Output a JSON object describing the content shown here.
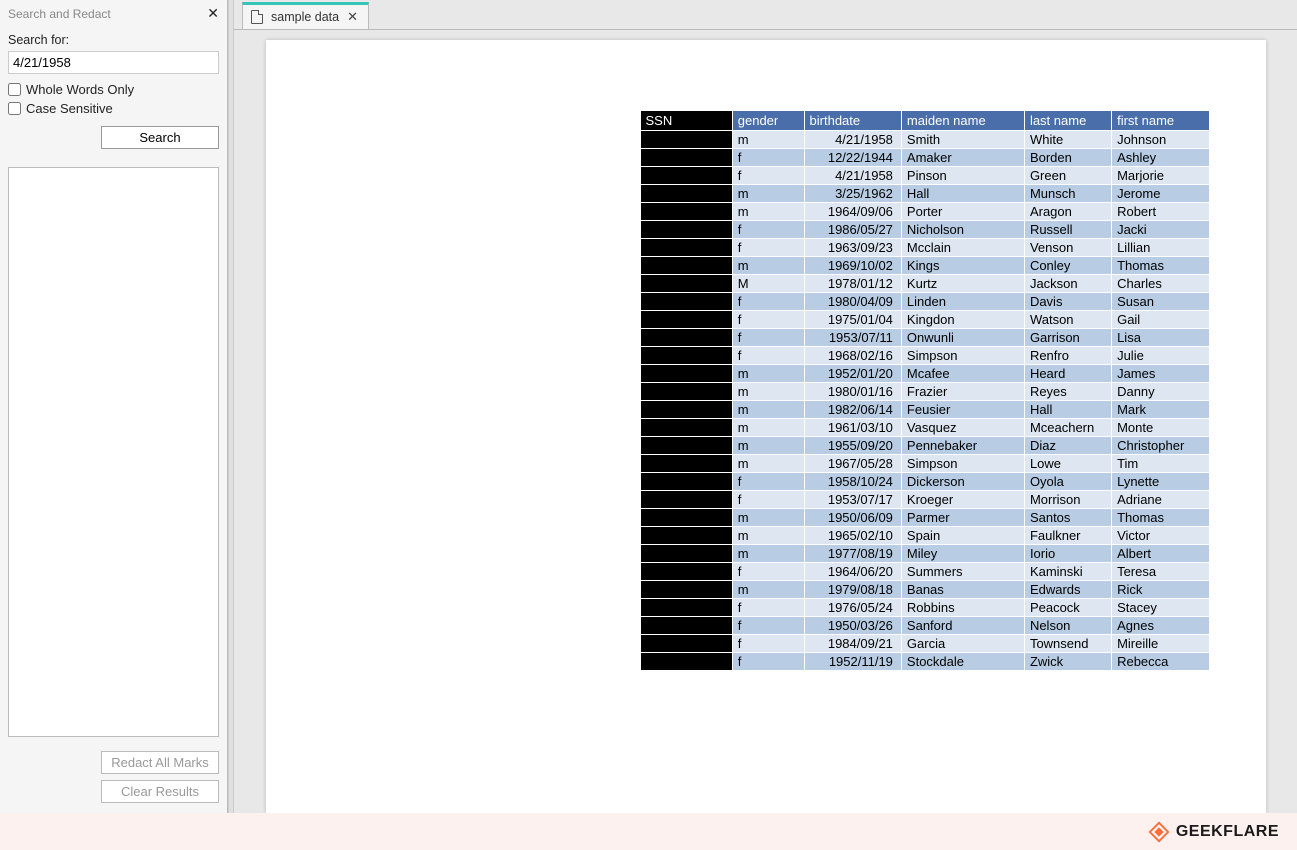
{
  "panel": {
    "title": "Search and Redact",
    "close": "✕",
    "search_label": "Search for:",
    "search_value": "4/21/1958",
    "whole_words": "Whole Words Only",
    "case_sensitive": "Case Sensitive",
    "search_btn": "Search",
    "redact_btn": "Redact All Marks",
    "clear_btn": "Clear Results"
  },
  "tab": {
    "label": "sample data",
    "close": "✕"
  },
  "table": {
    "headers": [
      "SSN",
      "gender",
      "birthdate",
      "maiden name",
      "last name",
      "first name"
    ],
    "rows": [
      {
        "g": "m",
        "bd": "4/21/1958",
        "mn": "Smith",
        "ln": "White",
        "fn": "Johnson"
      },
      {
        "g": "f",
        "bd": "12/22/1944",
        "mn": "Amaker",
        "ln": "Borden",
        "fn": "Ashley"
      },
      {
        "g": "f",
        "bd": "4/21/1958",
        "mn": "Pinson",
        "ln": "Green",
        "fn": "Marjorie"
      },
      {
        "g": "m",
        "bd": "3/25/1962",
        "mn": "Hall",
        "ln": "Munsch",
        "fn": "Jerome"
      },
      {
        "g": "m",
        "bd": "1964/09/06",
        "mn": "Porter",
        "ln": "Aragon",
        "fn": "Robert"
      },
      {
        "g": "f",
        "bd": "1986/05/27",
        "mn": "Nicholson",
        "ln": "Russell",
        "fn": "Jacki"
      },
      {
        "g": "f",
        "bd": "1963/09/23",
        "mn": "Mcclain",
        "ln": "Venson",
        "fn": "Lillian"
      },
      {
        "g": "m",
        "bd": "1969/10/02",
        "mn": "Kings",
        "ln": "Conley",
        "fn": "Thomas"
      },
      {
        "g": "M",
        "bd": "1978/01/12",
        "mn": "Kurtz",
        "ln": "Jackson",
        "fn": "Charles"
      },
      {
        "g": "f",
        "bd": "1980/04/09",
        "mn": "Linden",
        "ln": "Davis",
        "fn": "Susan"
      },
      {
        "g": "f",
        "bd": "1975/01/04",
        "mn": "Kingdon",
        "ln": "Watson",
        "fn": "Gail"
      },
      {
        "g": "f",
        "bd": "1953/07/11",
        "mn": "Onwunli",
        "ln": "Garrison",
        "fn": "Lisa"
      },
      {
        "g": "f",
        "bd": "1968/02/16",
        "mn": "Simpson",
        "ln": "Renfro",
        "fn": "Julie"
      },
      {
        "g": "m",
        "bd": "1952/01/20",
        "mn": "Mcafee",
        "ln": "Heard",
        "fn": "James"
      },
      {
        "g": "m",
        "bd": "1980/01/16",
        "mn": "Frazier",
        "ln": "Reyes",
        "fn": "Danny"
      },
      {
        "g": "m",
        "bd": "1982/06/14",
        "mn": "Feusier",
        "ln": "Hall",
        "fn": "Mark"
      },
      {
        "g": "m",
        "bd": "1961/03/10",
        "mn": "Vasquez",
        "ln": "Mceachern",
        "fn": "Monte"
      },
      {
        "g": "m",
        "bd": "1955/09/20",
        "mn": "Pennebaker",
        "ln": "Diaz",
        "fn": "Christopher"
      },
      {
        "g": "m",
        "bd": "1967/05/28",
        "mn": "Simpson",
        "ln": "Lowe",
        "fn": "Tim"
      },
      {
        "g": "f",
        "bd": "1958/10/24",
        "mn": "Dickerson",
        "ln": "Oyola",
        "fn": "Lynette"
      },
      {
        "g": "f",
        "bd": "1953/07/17",
        "mn": "Kroeger",
        "ln": "Morrison",
        "fn": "Adriane"
      },
      {
        "g": "m",
        "bd": "1950/06/09",
        "mn": "Parmer",
        "ln": "Santos",
        "fn": "Thomas"
      },
      {
        "g": "m",
        "bd": "1965/02/10",
        "mn": "Spain",
        "ln": "Faulkner",
        "fn": "Victor"
      },
      {
        "g": "m",
        "bd": "1977/08/19",
        "mn": "Miley",
        "ln": "Iorio",
        "fn": "Albert"
      },
      {
        "g": "f",
        "bd": "1964/06/20",
        "mn": "Summers",
        "ln": "Kaminski",
        "fn": "Teresa"
      },
      {
        "g": "m",
        "bd": "1979/08/18",
        "mn": "Banas",
        "ln": "Edwards",
        "fn": "Rick"
      },
      {
        "g": "f",
        "bd": "1976/05/24",
        "mn": "Robbins",
        "ln": "Peacock",
        "fn": "Stacey"
      },
      {
        "g": "f",
        "bd": "1950/03/26",
        "mn": "Sanford",
        "ln": "Nelson",
        "fn": "Agnes"
      },
      {
        "g": "f",
        "bd": "1984/09/21",
        "mn": "Garcia",
        "ln": "Townsend",
        "fn": "Mireille"
      },
      {
        "g": "f",
        "bd": "1952/11/19",
        "mn": "Stockdale",
        "ln": "Zwick",
        "fn": "Rebecca"
      }
    ]
  },
  "watermark": "GEEKFLARE"
}
